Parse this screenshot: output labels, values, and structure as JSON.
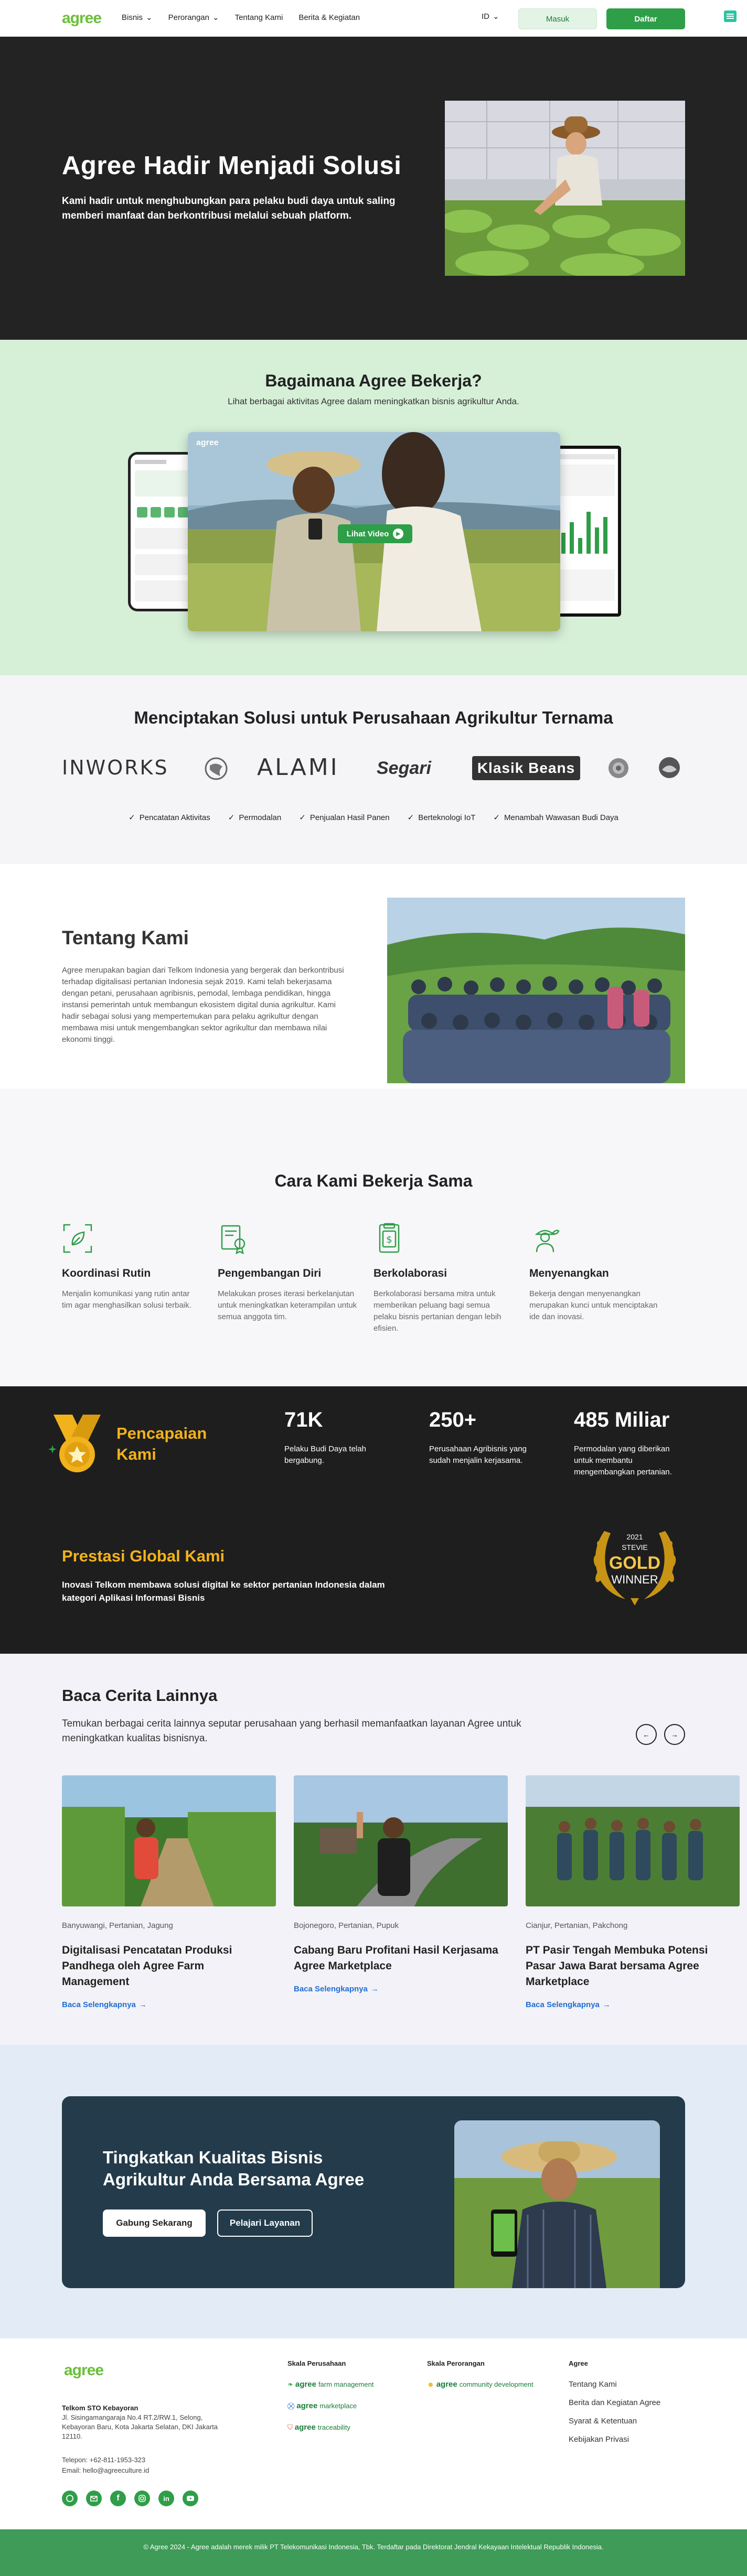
{
  "nav": {
    "logo": "agree",
    "menu": [
      {
        "label": "Bisnis",
        "dropdown": true
      },
      {
        "label": "Perorangan",
        "dropdown": true
      },
      {
        "label": "Tentang Kami",
        "dropdown": false
      },
      {
        "label": "Berita & Kegiatan",
        "dropdown": false
      }
    ],
    "lang": "ID",
    "login": "Masuk",
    "register": "Daftar"
  },
  "hero": {
    "title": "Agree Hadir Menjadi Solusi",
    "subtitle": "Kami hadir untuk menghubungkan para pelaku budi daya untuk saling memberi manfaat dan berkontribusi melalui sebuah platform."
  },
  "how": {
    "title": "Bagaimana Agree Bekerja?",
    "subtitle": "Lihat berbagai aktivitas Agree dalam meningkatkan bisnis agrikultur Anda.",
    "video_logo": "agree",
    "video_button": "Lihat Video"
  },
  "clients": {
    "title": "Menciptakan Solusi untuk Perusahaan Agrikultur Ternama",
    "logos": [
      "INWORKS",
      "ALAMI",
      "Segari",
      "Klasik Beans"
    ],
    "features": [
      "Pencatatan Aktivitas",
      "Permodalan",
      "Penjualan Hasil Panen",
      "Berteknologi IoT",
      "Menambah Wawasan Budi Daya"
    ]
  },
  "about": {
    "title": "Tentang Kami",
    "body": "Agree merupakan bagian dari Telkom Indonesia yang bergerak dan berkontribusi terhadap digitalisasi pertanian Indonesia sejak 2019. Kami telah bekerjasama dengan petani, perusahaan agribisnis, pemodal, lembaga pendidikan, hingga instansi pemerintah untuk membangun ekosistem digital dunia agrikultur. Kami hadir sebagai solusi yang mempertemukan para pelaku agrikultur dengan membawa misi untuk mengembangkan sektor agrikultur dan membawa nilai ekonomi tinggi."
  },
  "work": {
    "title": "Cara Kami Bekerja Sama",
    "items": [
      {
        "icon": "leaf-frame-icon",
        "title": "Koordinasi Rutin",
        "desc": "Menjalin komunikasi yang rutin antar tim agar menghasilkan solusi terbaik."
      },
      {
        "icon": "certificate-icon",
        "title": "Pengembangan Diri",
        "desc": "Melakukan proses iterasi berkelanjutan untuk meningkatkan keterampilan untuk semua anggota tim."
      },
      {
        "icon": "document-dollar-icon",
        "title": "Berkolaborasi",
        "desc": "Berkolaborasi bersama mitra untuk memberikan peluang bagi semua pelaku bisnis pertanian dengan lebih efisien."
      },
      {
        "icon": "farmer-icon",
        "title": "Menyenangkan",
        "desc": "Bekerja dengan menyenangkan merupakan kunci untuk menciptakan ide dan inovasi."
      }
    ]
  },
  "achievements": {
    "title": "Pencapaian Kami",
    "stats": [
      {
        "value": "71K",
        "desc": "Pelaku Budi Daya telah bergabung."
      },
      {
        "value": "250+",
        "desc": "Perusahaan Agribisnis yang sudah menjalin kerjasama."
      },
      {
        "value": "485 Miliar",
        "desc": "Permodalan yang diberikan untuk membantu mengembangkan pertanian."
      }
    ],
    "global_title": "Prestasi Global Kami",
    "global_desc": "Inovasi Telkom membawa solusi digital ke sektor pertanian Indonesia dalam kategori Aplikasi Informasi Bisnis",
    "award": {
      "year": "2021",
      "org": "STEVIE",
      "grade": "GOLD",
      "label": "WINNER"
    }
  },
  "stories": {
    "title": "Baca Cerita Lainnya",
    "desc": "Temukan berbagai cerita lainnya seputar perusahaan yang berhasil memanfaatkan layanan Agree untuk meningkatkan kualitas bisnisnya.",
    "more_label": "Baca Selengkapnya",
    "cards": [
      {
        "tags": "Banyuwangi, Pertanian, Jagung",
        "title": "Digitalisasi Pencatatan Produksi Pandhega oleh Agree Farm Management"
      },
      {
        "tags": "Bojonegoro, Pertanian, Pupuk",
        "title": "Cabang Baru Profitani Hasil Kerjasama Agree Marketplace"
      },
      {
        "tags": "Cianjur, Pertanian, Pakchong",
        "title": "PT Pasir Tengah Membuka Potensi Pasar Jawa Barat bersama Agree Marketplace"
      }
    ]
  },
  "cta": {
    "title": "Tingkatkan Kualitas Bisnis Agrikultur Anda Bersama Agree",
    "primary": "Gabung Sekarang",
    "secondary": "Pelajari Layanan"
  },
  "footer": {
    "logo": "agree",
    "address_title": "Telkom STO Kebayoran",
    "address": "Jl. Sisingamangaraja No.4 RT.2/RW.1, Selong, Kebayoran Baru, Kota Jakarta Selatan, DKI Jakarta 12110.",
    "phone": "Telepon: +62-811-1953-323",
    "email": "Email: hello@agreeculture.id",
    "col_company": {
      "title": "Skala Perusahaan",
      "items": [
        {
          "brand": "agree",
          "product": "farm management"
        },
        {
          "brand": "agree",
          "product": "marketplace"
        },
        {
          "brand": "agree",
          "product": "traceability"
        }
      ]
    },
    "col_personal": {
      "title": "Skala Perorangan",
      "items": [
        {
          "brand": "agree",
          "product": "community development"
        }
      ]
    },
    "col_agree": {
      "title": "Agree",
      "items": [
        "Tentang Kami",
        "Berita dan Kegiatan Agree",
        "Syarat & Ketentuan",
        "Kebijakan Privasi"
      ]
    },
    "copyright": "© Agree 2024 - Agree adalah merek milik PT Telekomunikasi Indonesia, Tbk. Terdaftar pada Direktorat Jendral Kekayaan Intelektual Republik Indonesia."
  },
  "colors": {
    "primary": "#2f9e48",
    "dark": "#232323",
    "gold": "#f2b21b",
    "link": "#1f6ed4"
  }
}
